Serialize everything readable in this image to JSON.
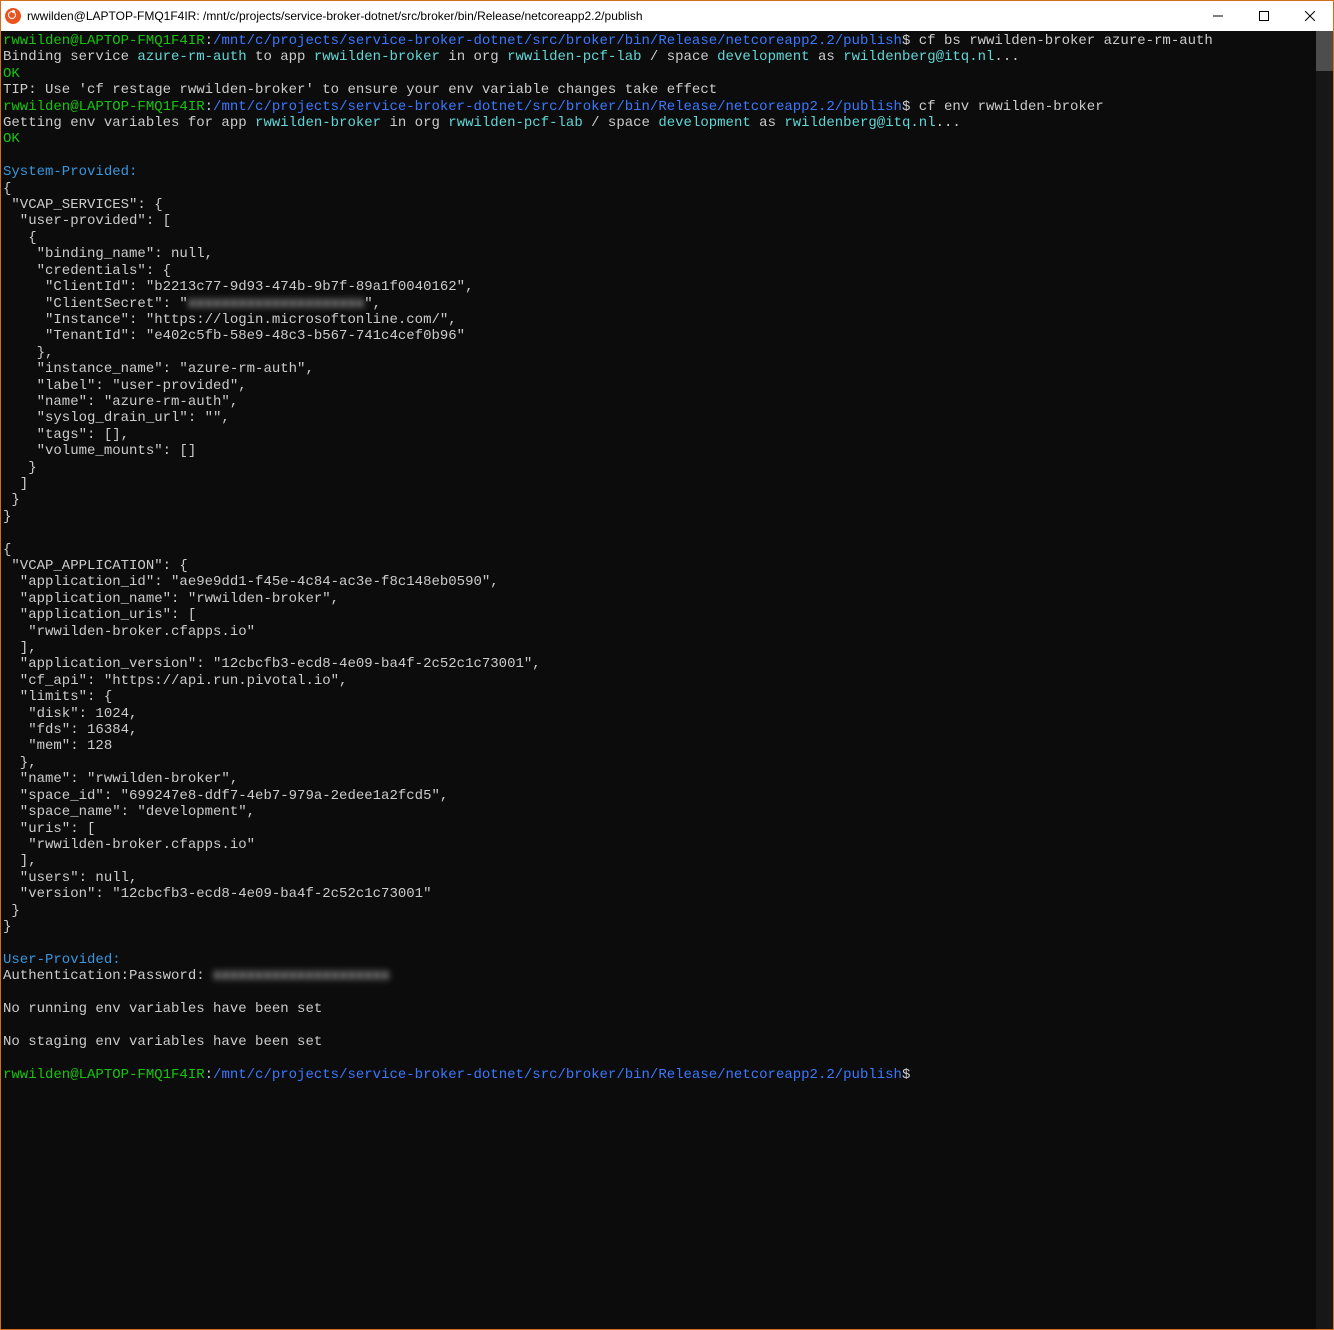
{
  "window": {
    "title": "rwwilden@LAPTOP-FMQ1F4IR: /mnt/c/projects/service-broker-dotnet/src/broker/bin/Release/netcoreapp2.2/publish"
  },
  "colors": {
    "prompt_user": "#16c60c",
    "prompt_path": "#3b78ff",
    "text": "#cccccc",
    "value_highlight": "#61d6d6",
    "section_header": "#3a96dd",
    "ok": "#16c60c",
    "background": "#0c0c0c"
  },
  "prompt": {
    "user_host": "rwwilden@LAPTOP-FMQ1F4IR",
    "sep": ":",
    "path": "/mnt/c/projects/service-broker-dotnet/src/broker/bin/Release/netcoreapp2.2/publish",
    "sym": "$"
  },
  "cmd1": "cf bs rwwilden-broker azure-rm-auth",
  "bind_line": {
    "p1": "Binding service ",
    "service": "azure-rm-auth",
    "p2": " to app ",
    "app": "rwwilden-broker",
    "p3": " in org ",
    "org": "rwwilden-pcf-lab",
    "p4": " / space ",
    "space": "development",
    "p5": " as ",
    "user": "rwildenberg@itq.nl",
    "p6": "..."
  },
  "ok": "OK",
  "tip": "TIP: Use 'cf restage rwwilden-broker' to ensure your env variable changes take effect",
  "cmd2": "cf env rwwilden-broker",
  "env_line": {
    "p1": "Getting env variables for app ",
    "app": "rwwilden-broker",
    "p2": " in org ",
    "org": "rwwilden-pcf-lab",
    "p3": " / space ",
    "space": "development",
    "p4": " as ",
    "user": "rwildenberg@itq.nl",
    "p5": "..."
  },
  "section_system": "System-Provided:",
  "vcap_services_block": "{\n \"VCAP_SERVICES\": {\n  \"user-provided\": [\n   {\n    \"binding_name\": null,\n    \"credentials\": {\n     \"ClientId\": \"b2213c77-9d93-474b-9b7f-89a1f0040162\",\n     \"ClientSecret\": \"",
  "secret_blur": "xxxxxxxxxxxxxxxxxxxxx",
  "vcap_services_block2": "\",\n     \"Instance\": \"https://login.microsoftonline.com/\",\n     \"TenantId\": \"e402c5fb-58e9-48c3-b567-741c4cef0b96\"\n    },\n    \"instance_name\": \"azure-rm-auth\",\n    \"label\": \"user-provided\",\n    \"name\": \"azure-rm-auth\",\n    \"syslog_drain_url\": \"\",\n    \"tags\": [],\n    \"volume_mounts\": []\n   }\n  ]\n }\n}\n",
  "vcap_application_block": "\n{\n \"VCAP_APPLICATION\": {\n  \"application_id\": \"ae9e9dd1-f45e-4c84-ac3e-f8c148eb0590\",\n  \"application_name\": \"rwwilden-broker\",\n  \"application_uris\": [\n   \"rwwilden-broker.cfapps.io\"\n  ],\n  \"application_version\": \"12cbcfb3-ecd8-4e09-ba4f-2c52c1c73001\",\n  \"cf_api\": \"https://api.run.pivotal.io\",\n  \"limits\": {\n   \"disk\": 1024,\n   \"fds\": 16384,\n   \"mem\": 128\n  },\n  \"name\": \"rwwilden-broker\",\n  \"space_id\": \"699247e8-ddf7-4eb7-979a-2edee1a2fcd5\",\n  \"space_name\": \"development\",\n  \"uris\": [\n   \"rwwilden-broker.cfapps.io\"\n  ],\n  \"users\": null,\n  \"version\": \"12cbcfb3-ecd8-4e09-ba4f-2c52c1c73001\"\n }\n}\n",
  "section_user": "User-Provided:",
  "auth_label": "Authentication:Password: ",
  "auth_blur": "xxxxxxxxxxxxxxxxxxxxx",
  "no_running": "No running env variables have been set",
  "no_staging": "No staging env variables have been set"
}
